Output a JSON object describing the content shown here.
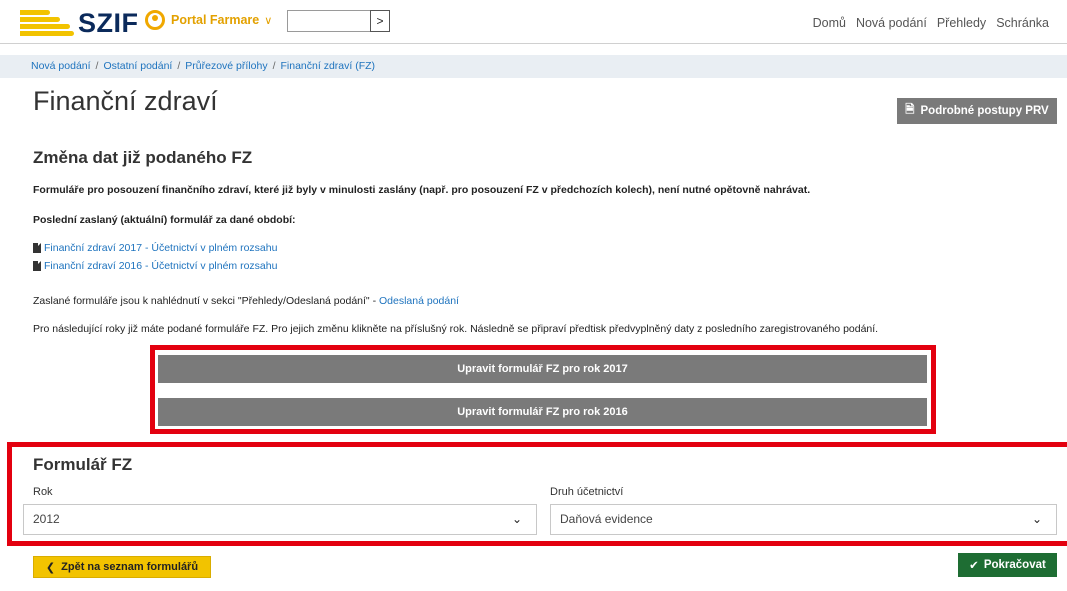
{
  "header": {
    "logo_text": "SZIF",
    "portal_label": "Portal Farmare",
    "search_button_icon": "chevron-right-icon",
    "nav": [
      "Domů",
      "Nová podání",
      "Přehledy",
      "Schránka"
    ]
  },
  "breadcrumb": [
    "Nová podání",
    "Ostatní podání",
    "Průřezové přílohy",
    "Finanční zdraví (FZ)"
  ],
  "page": {
    "title": "Finanční zdraví",
    "procedures_button": "Podrobné postupy PRV",
    "subtitle": "Změna dat již podaného FZ",
    "notice": "Formuláře pro posouzení finančního zdraví, které již byly v minulosti zaslány (např. pro posouzení FZ v předchozích kolech), není nutné opětovně nahrávat.",
    "last_sent_label": "Poslední zaslaný (aktuální) formulář za dané období:",
    "files": [
      "Finanční zdraví 2017 - Účetnictví v plném rozsahu",
      "Finanční zdraví 2016 - Účetnictví v plném rozsahu"
    ],
    "sent_info_text": "Zaslané formuláře jsou k nahlédnutí v sekci \"Přehledy/Odeslaná podání\" - ",
    "sent_info_link": "Odeslaná podání",
    "years_info": "Pro následující roky již máte podané formuláře FZ. Pro jejich změnu klikněte na příslušný rok. Následně se připraví předtisk předvyplněný daty z posledního zaregistrovaného podání.",
    "edit_buttons": [
      "Upravit formulář FZ pro rok 2017",
      "Upravit formulář FZ pro rok 2016"
    ]
  },
  "form": {
    "title": "Formulář FZ",
    "year_label": "Rok",
    "year_value": "2012",
    "accounting_label": "Druh účetnictví",
    "accounting_value": "Daňová evidence"
  },
  "footer": {
    "back_button": "Zpět na seznam formulářů",
    "continue_button": "Pokračovat"
  },
  "colors": {
    "highlight_red": "#e3000f",
    "brand_yellow": "#f2c300",
    "brand_navy": "#0b2a5b",
    "continue_green": "#1e6d33",
    "link_blue": "#1e73be"
  }
}
